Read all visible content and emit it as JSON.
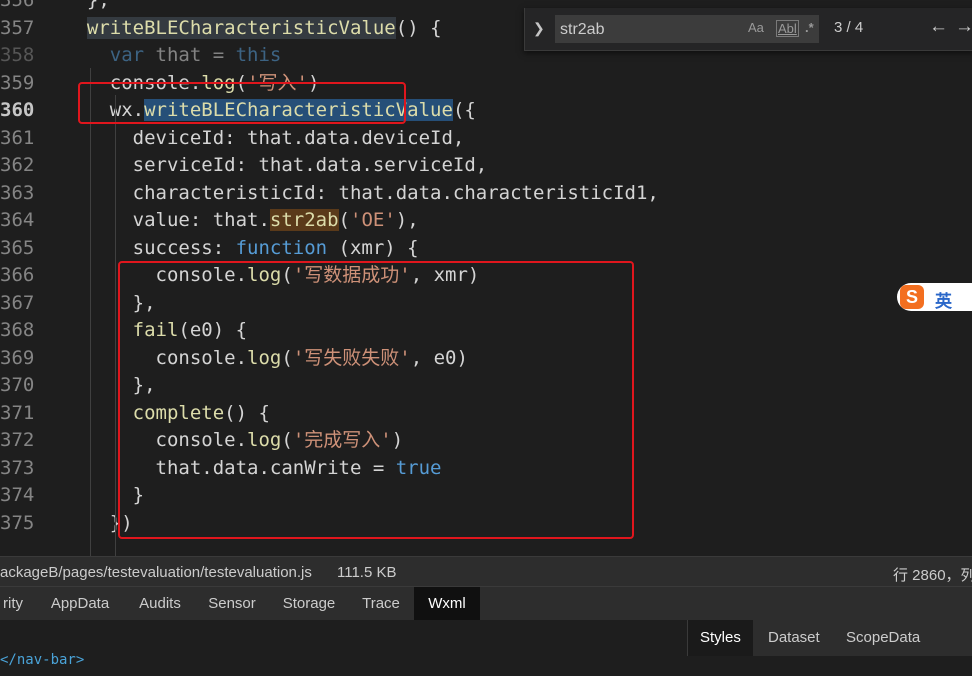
{
  "editor": {
    "lines": [
      {
        "n": "356",
        "tokens": [
          {
            "t": "  },",
            "c": "plain"
          }
        ]
      },
      {
        "n": "357",
        "tokens": [
          {
            "t": "  ",
            "c": "plain"
          },
          {
            "t": "writeBLECharacteristicValue",
            "c": "fn hlw"
          },
          {
            "t": "() {",
            "c": "plain"
          }
        ]
      },
      {
        "n": "358",
        "tokens": [
          {
            "t": "    ",
            "c": "plain"
          },
          {
            "t": "var",
            "c": "kw"
          },
          {
            "t": " that = ",
            "c": "plain"
          },
          {
            "t": "this",
            "c": "kw"
          }
        ]
      },
      {
        "n": "359",
        "tokens": [
          {
            "t": "    console.",
            "c": "plain"
          },
          {
            "t": "log",
            "c": "fn"
          },
          {
            "t": "(",
            "c": "plain"
          },
          {
            "t": "'写入'",
            "c": "str"
          },
          {
            "t": ")",
            "c": "plain"
          }
        ]
      },
      {
        "n": "360",
        "cur": true,
        "tokens": [
          {
            "t": "    wx.",
            "c": "plain"
          },
          {
            "t": "writeBLECharacteristicValue",
            "c": "fn sel"
          },
          {
            "t": "({",
            "c": "plain"
          }
        ]
      },
      {
        "n": "361",
        "tokens": [
          {
            "t": "      deviceId: that.data.deviceId,",
            "c": "plain"
          }
        ]
      },
      {
        "n": "362",
        "tokens": [
          {
            "t": "      serviceId: that.data.serviceId,",
            "c": "plain"
          }
        ]
      },
      {
        "n": "363",
        "tokens": [
          {
            "t": "      characteristicId: that.data.characteristicId1,",
            "c": "plain"
          }
        ]
      },
      {
        "n": "364",
        "tokens": [
          {
            "t": "      value: that.",
            "c": "plain"
          },
          {
            "t": "str2ab",
            "c": "fn hl"
          },
          {
            "t": "(",
            "c": "plain"
          },
          {
            "t": "'OE'",
            "c": "str"
          },
          {
            "t": "),",
            "c": "plain"
          }
        ]
      },
      {
        "n": "365",
        "tokens": [
          {
            "t": "      success: ",
            "c": "plain"
          },
          {
            "t": "function",
            "c": "kw"
          },
          {
            "t": " (xmr) {",
            "c": "plain"
          }
        ]
      },
      {
        "n": "366",
        "tokens": [
          {
            "t": "        console.",
            "c": "plain"
          },
          {
            "t": "log",
            "c": "fn"
          },
          {
            "t": "(",
            "c": "plain"
          },
          {
            "t": "'写数据成功'",
            "c": "str"
          },
          {
            "t": ", xmr)",
            "c": "plain"
          }
        ]
      },
      {
        "n": "367",
        "tokens": [
          {
            "t": "      },",
            "c": "plain"
          }
        ]
      },
      {
        "n": "368",
        "tokens": [
          {
            "t": "      ",
            "c": "plain"
          },
          {
            "t": "fail",
            "c": "fn"
          },
          {
            "t": "(e0) {",
            "c": "plain"
          }
        ]
      },
      {
        "n": "369",
        "tokens": [
          {
            "t": "        console.",
            "c": "plain"
          },
          {
            "t": "log",
            "c": "fn"
          },
          {
            "t": "(",
            "c": "plain"
          },
          {
            "t": "'写失败失败'",
            "c": "str"
          },
          {
            "t": ", e0)",
            "c": "plain"
          }
        ]
      },
      {
        "n": "370",
        "tokens": [
          {
            "t": "      },",
            "c": "plain"
          }
        ]
      },
      {
        "n": "371",
        "tokens": [
          {
            "t": "      ",
            "c": "plain"
          },
          {
            "t": "complete",
            "c": "fn"
          },
          {
            "t": "() {",
            "c": "plain"
          }
        ]
      },
      {
        "n": "372",
        "tokens": [
          {
            "t": "        console.",
            "c": "plain"
          },
          {
            "t": "log",
            "c": "fn"
          },
          {
            "t": "(",
            "c": "plain"
          },
          {
            "t": "'完成写入'",
            "c": "str"
          },
          {
            "t": ")",
            "c": "plain"
          }
        ]
      },
      {
        "n": "373",
        "tokens": [
          {
            "t": "        that.data.canWrite = ",
            "c": "plain"
          },
          {
            "t": "true",
            "c": "kw"
          }
        ]
      },
      {
        "n": "374",
        "tokens": [
          {
            "t": "      }",
            "c": "plain"
          }
        ]
      },
      {
        "n": "375",
        "tokens": [
          {
            "t": "    })",
            "c": "plain"
          }
        ]
      }
    ]
  },
  "find_widget": {
    "query": "str2ab",
    "match_case": "Aa",
    "whole_word": "Abl",
    "regex": ".*",
    "count": "3 / 4",
    "prev": "←",
    "next": "→"
  },
  "ime": {
    "logo": "S",
    "mode": "英"
  },
  "status_bar": {
    "path": "ackageB/pages/testevaluation/testevaluation.js",
    "size": "111.5 KB",
    "position": "行 2860，列"
  },
  "devtools_tabs": [
    "rity",
    "AppData",
    "Audits",
    "Sensor",
    "Storage",
    "Trace",
    "Wxml"
  ],
  "devtools_active": "Wxml",
  "panel": {
    "navbar_tag": "</nav-bar>",
    "right_tabs": [
      "Styles",
      "Dataset",
      "ScopeData"
    ]
  }
}
